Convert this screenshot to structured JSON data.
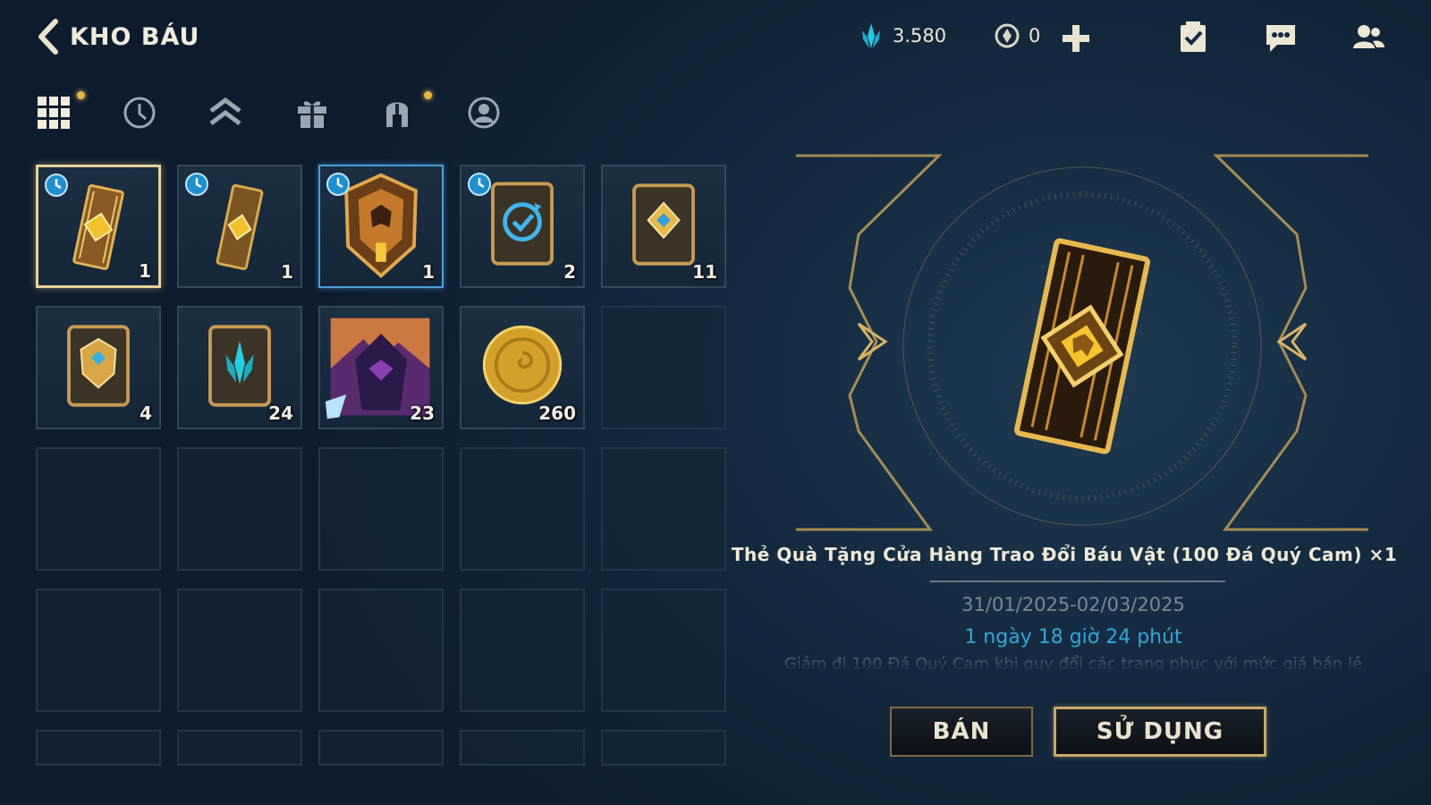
{
  "header": {
    "title": "KHO BÁU",
    "currency_gems": "3.580",
    "currency_tokens": "0"
  },
  "filter_tabs": [
    {
      "icon": "grid-icon",
      "has_dot": true
    },
    {
      "icon": "clock-icon",
      "has_dot": false
    },
    {
      "icon": "rank-up-icon",
      "has_dot": false
    },
    {
      "icon": "gift-icon",
      "has_dot": false
    },
    {
      "icon": "helmet-icon",
      "has_dot": true
    },
    {
      "icon": "profile-icon",
      "has_dot": false
    }
  ],
  "inventory": [
    {
      "icon": "ticket-card-icon",
      "count": "1",
      "timed": true,
      "selected": true
    },
    {
      "icon": "ticket-card-icon",
      "count": "1",
      "timed": true
    },
    {
      "icon": "shield-emblem-icon",
      "count": "1",
      "timed": true
    },
    {
      "icon": "refresh-card-icon",
      "count": "2",
      "timed": true
    },
    {
      "icon": "diamond-card-icon",
      "count": "11"
    },
    {
      "icon": "gem-card-icon",
      "count": "4"
    },
    {
      "icon": "crystal-card-icon",
      "count": "24"
    },
    {
      "icon": "skin-portrait-icon",
      "count": "23"
    },
    {
      "icon": "gold-coin-icon",
      "count": "260"
    }
  ],
  "detail": {
    "item_name": "Thẻ Quà Tặng Cửa Hàng Trao Đổi Báu Vật (100 Đá Quý Cam) ×1",
    "dates": "31/01/2025-02/03/2025",
    "remaining": "1 ngày 18 giờ 24 phút",
    "description": "Giảm đi 100 Đá Quý Cam khi quy đổi các trang phục với mức giá bán lẻ",
    "sell_label": "BÁN",
    "use_label": "SỬ DỤNG"
  },
  "colors": {
    "gold": "#e8c260",
    "accent_blue": "#2fa8d8",
    "background": "#132a40"
  }
}
